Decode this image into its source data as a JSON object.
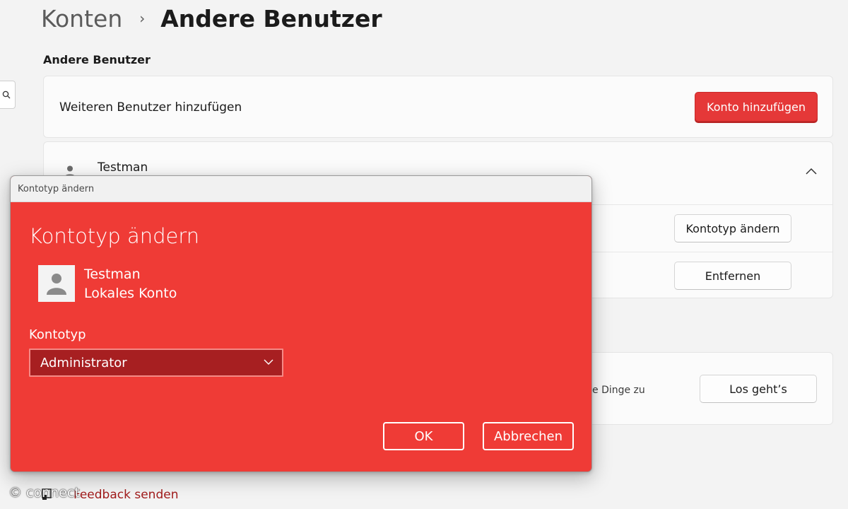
{
  "breadcrumb": {
    "parent": "Konten",
    "separator": "›",
    "current": "Andere Benutzer"
  },
  "section_title": "Andere Benutzer",
  "add_user_card": {
    "label": "Weiteren Benutzer hinzufügen",
    "button_label": "Konto hinzufügen"
  },
  "user_card": {
    "name": "Testman",
    "change_type_button": "Kontotyp ändern",
    "remove_button": "Entfernen"
  },
  "kiosk_card": {
    "text_fragment": "e Dinge zu",
    "button_label": "Los geht’s"
  },
  "feedback_link": "Feedback senden",
  "watermark": "© connect",
  "dialog": {
    "window_title": "Kontotyp ändern",
    "heading": "Kontotyp ändern",
    "user_name": "Testman",
    "user_account_type": "Lokales Konto",
    "field_label": "Kontotyp",
    "selected_value": "Administrator",
    "ok_label": "OK",
    "cancel_label": "Abbrechen"
  },
  "colors": {
    "accent": "#e53838",
    "dialog_background": "#ef3b36",
    "select_background": "#a71f21",
    "page_background": "#f3f3f3"
  },
  "icons": {
    "search": "search-icon",
    "user": "user-icon",
    "chevron_up": "chevron-up-icon",
    "chevron_down": "chevron-down-icon",
    "feedback": "feedback-icon"
  }
}
